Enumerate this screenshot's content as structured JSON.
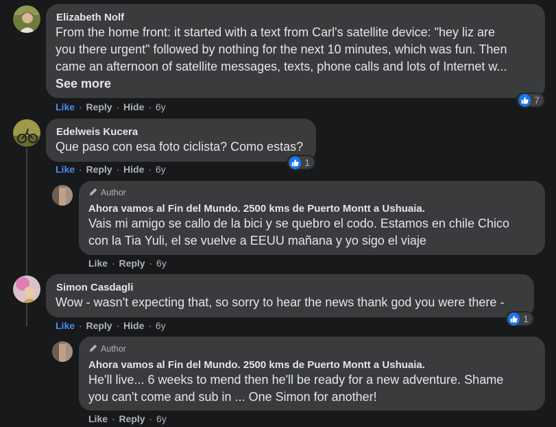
{
  "actions": {
    "like": "Like",
    "reply": "Reply",
    "hide": "Hide",
    "sep": "·"
  },
  "comments": [
    {
      "name": "Elizabeth Nolf",
      "text_lines": [
        "From the home front: it started with a text from Carl's satellite device: \"hey liz are",
        "you there urgent\" followed by nothing for the next 10 minutes, which was fun. Then",
        "came an afternoon of satellite messages, texts, phone calls and lots of Internet w..."
      ],
      "see_more": "See more",
      "time": "6y",
      "reactions": "7"
    },
    {
      "name": "Edelweis Kucera",
      "text_lines": [
        "Que paso con esa foto ciclista? Como estas?"
      ],
      "time": "6y",
      "reactions": "1"
    },
    {
      "badge": "Author",
      "name": "Ahora vamos al Fin del Mundo. 2500 kms de Puerto Montt a Ushuaia.",
      "text_lines": [
        "Vais mi amigo se callo de la bici y se quebro el codo. Estamos en chile Chico",
        "con la Tia Yuli, el se vuelve a EEUU mañana y yo sigo el viaje"
      ],
      "time": "6y"
    },
    {
      "name": "Simon Casdagli",
      "text_lines": [
        "Wow - wasn't expecting that, so sorry to hear the news thank god you were there -"
      ],
      "time": "6y",
      "reactions": "1"
    },
    {
      "badge": "Author",
      "name": "Ahora vamos al Fin del Mundo. 2500 kms de Puerto Montt a Ushuaia.",
      "text_lines": [
        "He'll live... 6 weeks to mend then he'll be ready for a new adventure. Shame",
        "you can't come and sub in ... One Simon for another!"
      ],
      "time": "6y"
    }
  ],
  "colors": {
    "background": "#18191a",
    "bubble": "#3a3b3c",
    "like_blue": "#4c8bf5",
    "muted": "#b0b3b8"
  }
}
